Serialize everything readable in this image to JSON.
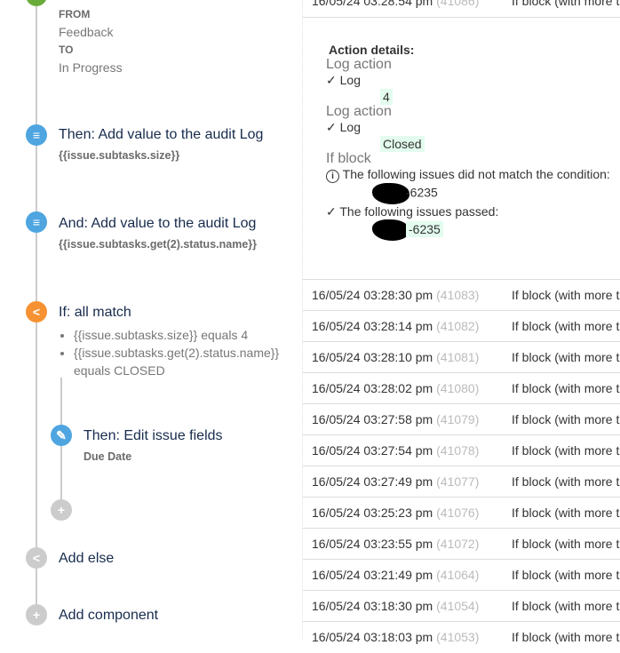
{
  "flow": {
    "from_label": "FROM",
    "from_value": "Feedback",
    "to_label": "TO",
    "to_value": "In Progress",
    "steps": [
      {
        "title": "Then: Add value to the audit Log",
        "sub": "{{issue.subtasks.size}}"
      },
      {
        "title": "And: Add value to the audit Log",
        "sub": "{{issue.subtasks.get(2).status.name}}"
      }
    ],
    "if_block": {
      "title": "If: all match",
      "conditions": [
        "{{issue.subtasks.size}} equals 4",
        "{{issue.subtasks.get(2).status.name}} equals CLOSED"
      ],
      "then_title": "Then: Edit issue fields",
      "then_sub": "Due Date"
    },
    "add_else": "Add else",
    "add_component": "Add component"
  },
  "log": {
    "top_row": {
      "time": "16/05/24 03:28:54 pm",
      "id": "(41086)",
      "desc": "If block (with more th"
    },
    "details": {
      "heading": "Action details:",
      "log1_title": "Log action",
      "log1_label": "Log",
      "log1_value": "4",
      "log2_title": "Log action",
      "log2_label": "Log",
      "log2_value": "Closed",
      "if_title": "If block",
      "not_match": "The following issues did not match the condition:",
      "not_match_issue": "-6235",
      "passed": "The following issues passed:",
      "passed_issue": "-6235"
    },
    "rows": [
      {
        "time": "16/05/24 03:28:30 pm",
        "id": "(41083)",
        "desc": "If block (with more th"
      },
      {
        "time": "16/05/24 03:28:14 pm",
        "id": "(41082)",
        "desc": "If block (with more th"
      },
      {
        "time": "16/05/24 03:28:10 pm",
        "id": "(41081)",
        "desc": "If block (with more th"
      },
      {
        "time": "16/05/24 03:28:02 pm",
        "id": "(41080)",
        "desc": "If block (with more th"
      },
      {
        "time": "16/05/24 03:27:58 pm",
        "id": "(41079)",
        "desc": "If block (with more th"
      },
      {
        "time": "16/05/24 03:27:54 pm",
        "id": "(41078)",
        "desc": "If block (with more th"
      },
      {
        "time": "16/05/24 03:27:49 pm",
        "id": "(41077)",
        "desc": "If block (with more th"
      },
      {
        "time": "16/05/24 03:25:23 pm",
        "id": "(41076)",
        "desc": "If block (with more th"
      },
      {
        "time": "16/05/24 03:23:55 pm",
        "id": "(41072)",
        "desc": "If block (with more th"
      },
      {
        "time": "16/05/24 03:21:49 pm",
        "id": "(41064)",
        "desc": "If block (with more th"
      },
      {
        "time": "16/05/24 03:18:30 pm",
        "id": "(41054)",
        "desc": "If block (with more th"
      },
      {
        "time": "16/05/24 03:18:03 pm",
        "id": "(41053)",
        "desc": "If block (with more th"
      }
    ]
  },
  "colors": {
    "green": "#6aac3a",
    "blue": "#4ea5e0",
    "orange": "#f79232",
    "grey": "#ccc",
    "highlight": "#e3fcef"
  }
}
